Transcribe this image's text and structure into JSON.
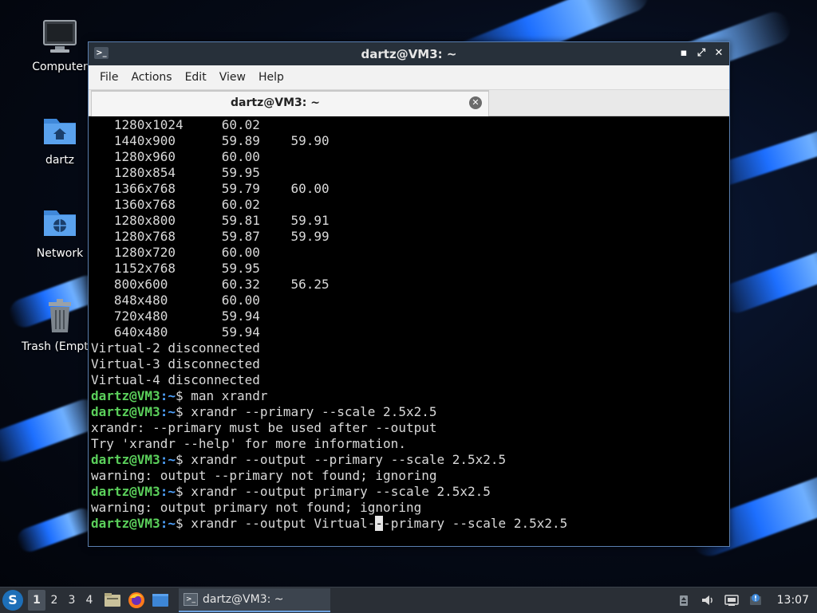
{
  "desktop": {
    "icons": [
      {
        "label": "Computer",
        "icon": "computer-icon"
      },
      {
        "label": "dartz",
        "icon": "home-folder-icon"
      },
      {
        "label": "Network",
        "icon": "network-folder-icon"
      },
      {
        "label": "Trash (Empty)",
        "icon": "trash-icon"
      }
    ]
  },
  "window": {
    "title": "dartz@VM3: ~",
    "menu": [
      "File",
      "Actions",
      "Edit",
      "View",
      "Help"
    ],
    "tab_label": "dartz@VM3: ~"
  },
  "terminal": {
    "prompt_user": "dartz@VM3",
    "prompt_path": ":~",
    "prompt_symbol": "$ ",
    "lines": [
      {
        "type": "out",
        "text": "   1280x1024     60.02"
      },
      {
        "type": "out",
        "text": "   1440x900      59.89    59.90"
      },
      {
        "type": "out",
        "text": "   1280x960      60.00"
      },
      {
        "type": "out",
        "text": "   1280x854      59.95"
      },
      {
        "type": "out",
        "text": "   1366x768      59.79    60.00"
      },
      {
        "type": "out",
        "text": "   1360x768      60.02"
      },
      {
        "type": "out",
        "text": "   1280x800      59.81    59.91"
      },
      {
        "type": "out",
        "text": "   1280x768      59.87    59.99"
      },
      {
        "type": "out",
        "text": "   1280x720      60.00"
      },
      {
        "type": "out",
        "text": "   1152x768      59.95"
      },
      {
        "type": "out",
        "text": "   800x600       60.32    56.25"
      },
      {
        "type": "out",
        "text": "   848x480       60.00"
      },
      {
        "type": "out",
        "text": "   720x480       59.94"
      },
      {
        "type": "out",
        "text": "   640x480       59.94"
      },
      {
        "type": "out",
        "text": "Virtual-2 disconnected"
      },
      {
        "type": "out",
        "text": "Virtual-3 disconnected"
      },
      {
        "type": "out",
        "text": "Virtual-4 disconnected"
      },
      {
        "type": "cmd",
        "text": "man xrandr"
      },
      {
        "type": "cmd",
        "text": "xrandr --primary --scale 2.5x2.5"
      },
      {
        "type": "out",
        "text": "xrandr: --primary must be used after --output"
      },
      {
        "type": "out",
        "text": "Try 'xrandr --help' for more information."
      },
      {
        "type": "cmd",
        "text": "xrandr --output --primary --scale 2.5x2.5"
      },
      {
        "type": "out",
        "text": "warning: output --primary not found; ignoring"
      },
      {
        "type": "cmd",
        "text": "xrandr --output primary --scale 2.5x2.5"
      },
      {
        "type": "out",
        "text": "warning: output primary not found; ignoring"
      },
      {
        "type": "cmd_cursor",
        "before": "xrandr --output Virtual-",
        "cursor_char": "-",
        "after": "-primary --scale 2.5x2.5"
      }
    ]
  },
  "taskbar": {
    "start_label": "S",
    "workspaces": [
      "1",
      "2",
      "3",
      "4"
    ],
    "active_workspace": "1",
    "launchers": [
      "file-manager-icon",
      "firefox-icon",
      "show-desktop-icon"
    ],
    "task_label": "dartz@VM3: ~",
    "tray_icons": [
      "removable-media-icon",
      "volume-icon",
      "network-icon",
      "notification-icon"
    ],
    "clock": "13:07"
  }
}
